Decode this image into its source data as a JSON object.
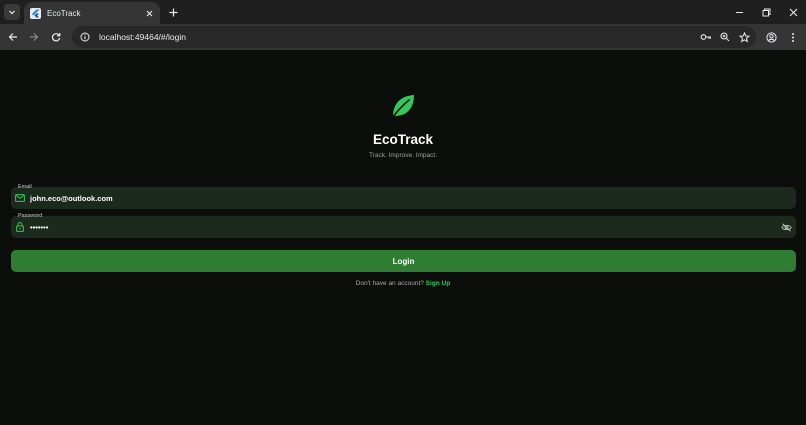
{
  "browser": {
    "tab_title": "EcoTrack",
    "url": "localhost:49464/#/login"
  },
  "app": {
    "name": "EcoTrack",
    "tagline": "Track. Improve. Impact.",
    "accent": "#34c759",
    "button_color": "#2e7d32",
    "field_bg": "#1b2a1c"
  },
  "form": {
    "email_label": "Email",
    "email_value": "john.eco@outlook.com",
    "password_label": "Password",
    "password_value": "•••••••",
    "login_label": "Login"
  },
  "footer": {
    "prompt": "Don't have an account?",
    "signup_label": "Sign Up"
  },
  "icons": {
    "logo": "leaf-icon",
    "email": "mail-icon",
    "password": "lock-icon",
    "toggle_visibility": "eye-off-icon"
  }
}
